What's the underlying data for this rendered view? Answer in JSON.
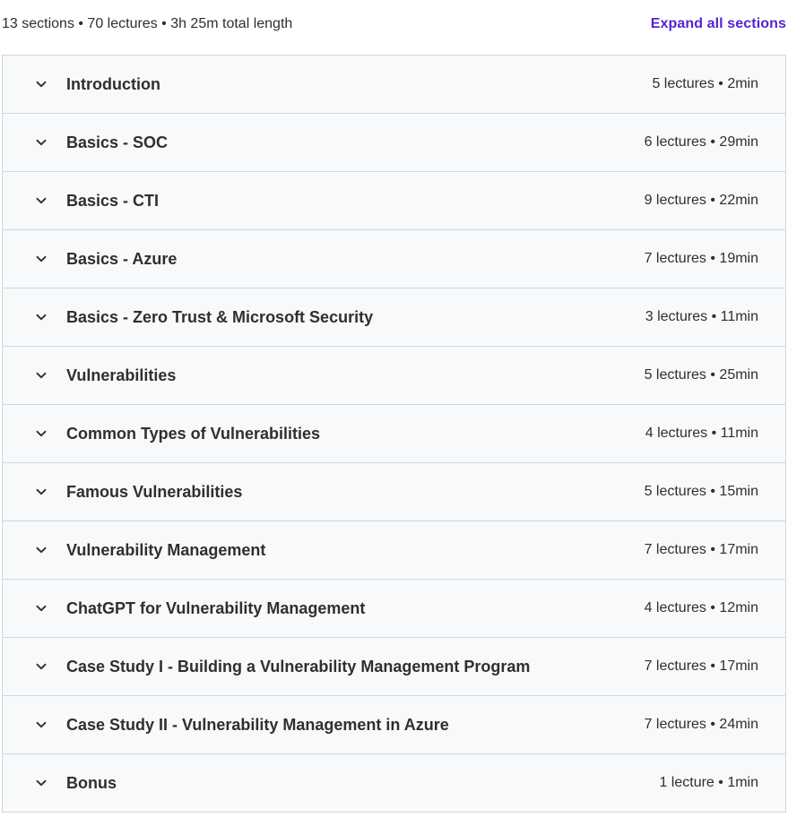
{
  "summary": {
    "text": "13 sections • 70 lectures • 3h 25m total length",
    "expand_label": "Expand all sections"
  },
  "colors": {
    "accent": "#5624d0",
    "text": "#2d2f31",
    "row_bg": "#f7f9fa",
    "border": "#d1d7dc"
  },
  "sections": [
    {
      "title": "Introduction",
      "meta": "5 lectures • 2min",
      "icon": "chevron-down-icon"
    },
    {
      "title": "Basics - SOC",
      "meta": "6 lectures • 29min",
      "icon": "chevron-down-icon"
    },
    {
      "title": "Basics - CTI",
      "meta": "9 lectures • 22min",
      "icon": "chevron-down-icon"
    },
    {
      "title": "Basics - Azure",
      "meta": "7 lectures • 19min",
      "icon": "chevron-down-icon"
    },
    {
      "title": "Basics - Zero Trust & Microsoft Security",
      "meta": "3 lectures • 11min",
      "icon": "chevron-down-icon"
    },
    {
      "title": "Vulnerabilities",
      "meta": "5 lectures • 25min",
      "icon": "chevron-down-icon"
    },
    {
      "title": "Common Types of Vulnerabilities",
      "meta": "4 lectures • 11min",
      "icon": "chevron-down-icon"
    },
    {
      "title": "Famous Vulnerabilities",
      "meta": "5 lectures • 15min",
      "icon": "chevron-down-icon"
    },
    {
      "title": "Vulnerability Management",
      "meta": "7 lectures • 17min",
      "icon": "chevron-down-icon"
    },
    {
      "title": "ChatGPT for Vulnerability Management",
      "meta": "4 lectures • 12min",
      "icon": "chevron-down-icon"
    },
    {
      "title": "Case Study I - Building a Vulnerability Management Program",
      "meta": "7 lectures • 17min",
      "icon": "chevron-down-icon"
    },
    {
      "title": "Case Study II - Vulnerability Management in Azure",
      "meta": "7 lectures • 24min",
      "icon": "chevron-down-icon"
    },
    {
      "title": "Bonus",
      "meta": "1 lecture • 1min",
      "icon": "chevron-down-icon"
    }
  ]
}
